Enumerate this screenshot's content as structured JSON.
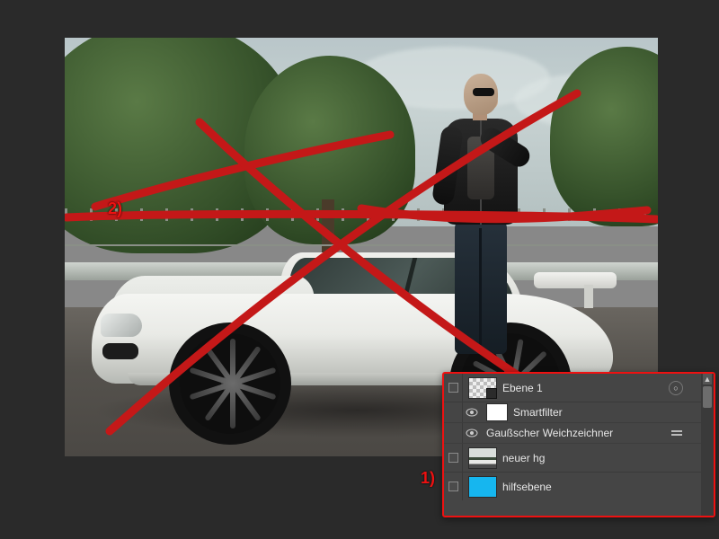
{
  "annotations": {
    "label1": "1)",
    "label2": "2)"
  },
  "layers_panel": {
    "layer1": {
      "name": "Ebene 1",
      "smartfilter_label": "Smartfilter",
      "filter1": "Gaußscher Weichzeichner"
    },
    "layer2": {
      "name": "neuer hg"
    },
    "layer3": {
      "name": "hilfsebene",
      "swatch": "#16b6ef"
    }
  }
}
